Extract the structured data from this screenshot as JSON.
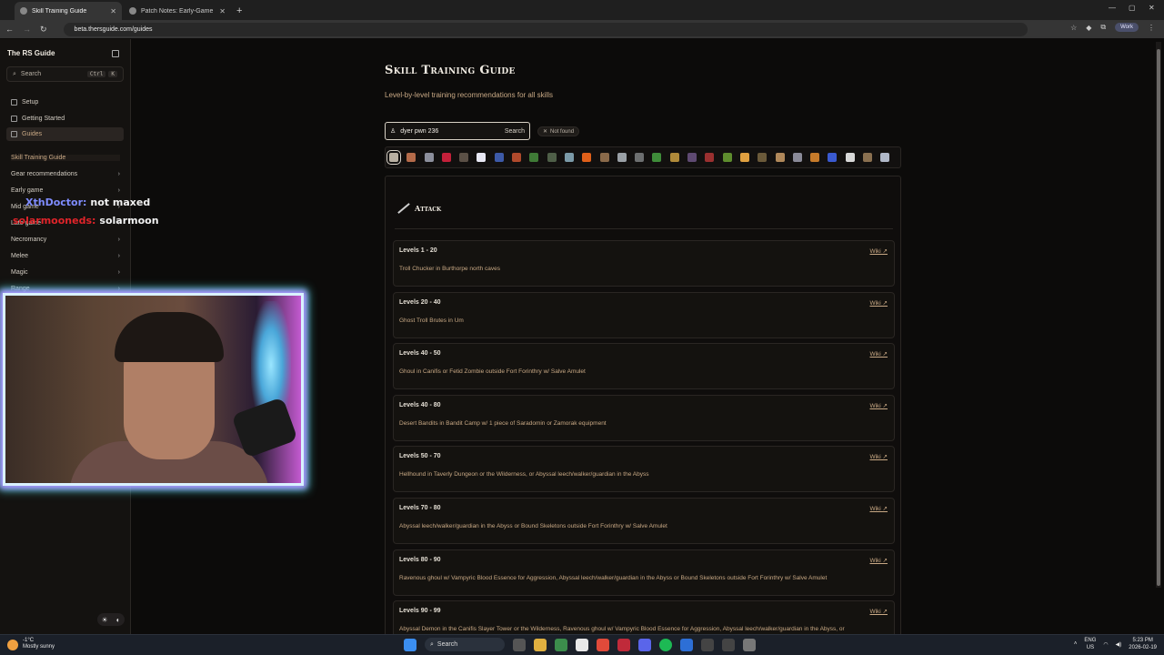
{
  "browser": {
    "tabs": [
      {
        "title": "Skill Training Guide",
        "active": true
      },
      {
        "title": "Patch Notes: Early-Game Rebal",
        "active": false
      }
    ],
    "new_tab": "+",
    "url": "beta.thersguide.com/guides",
    "profile": "Work"
  },
  "sidebar": {
    "site_title": "The RS Guide",
    "search": {
      "placeholder": "Search",
      "kbd": [
        "Ctrl",
        "K"
      ]
    },
    "nav": [
      {
        "label": "Setup"
      },
      {
        "label": "Getting Started"
      },
      {
        "label": "Guides",
        "active": true
      }
    ],
    "groups": [
      {
        "label": "Skill Training Guide",
        "active": true,
        "chevron": ""
      },
      {
        "label": "Gear recommendations",
        "chevron": "›"
      },
      {
        "label": "Early game",
        "chevron": "›"
      },
      {
        "label": "Mid game",
        "chevron": "›"
      },
      {
        "label": "Late game",
        "chevron": "›"
      },
      {
        "label": "Necromancy",
        "chevron": "›"
      },
      {
        "label": "Melee",
        "chevron": "›"
      },
      {
        "label": "Magic",
        "chevron": "›"
      },
      {
        "label": "Range",
        "chevron": "›"
      }
    ],
    "theme": {
      "light": "☀",
      "dark": "◐"
    }
  },
  "overlay": {
    "chat": [
      {
        "user": "XthDoctor:",
        "message": "not maxed"
      },
      {
        "user": "solarmooneds:",
        "message": "solarmoon"
      }
    ]
  },
  "main": {
    "title": "Skill Training Guide",
    "subtitle": "Level-by-level training recommendations for all skills",
    "search": {
      "value": "dyer pwn 236",
      "button": "Search"
    },
    "status_badge": "Not found",
    "skill_icons": [
      {
        "name": "attack",
        "color": "#b9b0a2"
      },
      {
        "name": "strength",
        "color": "#b56b4a"
      },
      {
        "name": "defence",
        "color": "#8c8f9c"
      },
      {
        "name": "constitution",
        "color": "#c4203a"
      },
      {
        "name": "ranged",
        "color": "#5b5046"
      },
      {
        "name": "prayer",
        "color": "#e8e8f4"
      },
      {
        "name": "magic",
        "color": "#3d5aa8"
      },
      {
        "name": "cooking",
        "color": "#b04a2c"
      },
      {
        "name": "woodcutting",
        "color": "#3f7a36"
      },
      {
        "name": "fletching",
        "color": "#4f5f48"
      },
      {
        "name": "fishing",
        "color": "#7b9aa8"
      },
      {
        "name": "firemaking",
        "color": "#e0601a"
      },
      {
        "name": "crafting",
        "color": "#8a6a4a"
      },
      {
        "name": "smithing",
        "color": "#9aa0a6"
      },
      {
        "name": "mining",
        "color": "#6d6f70"
      },
      {
        "name": "herblore",
        "color": "#3f8c3a"
      },
      {
        "name": "agility",
        "color": "#b08a3a"
      },
      {
        "name": "thieving",
        "color": "#5f4a72"
      },
      {
        "name": "slayer",
        "color": "#9a3030"
      },
      {
        "name": "farming",
        "color": "#5e8c2e"
      },
      {
        "name": "runecrafting",
        "color": "#e0a040"
      },
      {
        "name": "hunter",
        "color": "#6b5a3a"
      },
      {
        "name": "construction",
        "color": "#b0885a"
      },
      {
        "name": "summoning",
        "color": "#8a8a98"
      },
      {
        "name": "dungeoneering",
        "color": "#c67a2a"
      },
      {
        "name": "divination",
        "color": "#3a5ad0"
      },
      {
        "name": "invention",
        "color": "#d8d8d8"
      },
      {
        "name": "archaeology",
        "color": "#8a7050"
      },
      {
        "name": "necromancy",
        "color": "#b0b8c8"
      }
    ],
    "skill": {
      "name": "Attack"
    },
    "rows": [
      {
        "levels": "Levels 1 - 20",
        "wiki": "Wiki ↗",
        "desc": "Troll Chucker in Burthorpe north caves"
      },
      {
        "levels": "Levels 20 - 40",
        "wiki": "Wiki ↗",
        "desc": "Ghost Troll Brutes in Um"
      },
      {
        "levels": "Levels 40 - 50",
        "wiki": "Wiki ↗",
        "desc": "Ghoul in Canifis or Fetid Zombie outside Fort Forinthry w/ Salve Amulet"
      },
      {
        "levels": "Levels 40 - 80",
        "wiki": "Wiki ↗",
        "desc": "Desert Bandits in Bandit Camp w/ 1 piece of Saradomin or Zamorak equipment"
      },
      {
        "levels": "Levels 50 - 70",
        "wiki": "Wiki ↗",
        "desc": "Hellhound in Taverly Dungeon or the Wilderness, or Abyssal leech/walker/guardian in the Abyss"
      },
      {
        "levels": "Levels 70 - 80",
        "wiki": "Wiki ↗",
        "desc": "Abyssal leech/walker/guardian in the Abyss or Bound Skeletons outside Fort Forinthry w/ Salve Amulet"
      },
      {
        "levels": "Levels 80 - 90",
        "wiki": "Wiki ↗",
        "desc": "Ravenous ghoul w/ Vampyric Blood Essence for Aggression, Abyssal leech/walker/guardian in the Abyss or Bound Skeletons outside Fort Forinthry w/ Salve Amulet"
      },
      {
        "levels": "Levels 90 - 99",
        "wiki": "Wiki ↗",
        "desc": "Abyssal Demon in the Canifis Slayer Tower or the Wilderness, Ravenous ghoul w/ Vampyric Blood Essence for Aggression, Abyssal leech/walker/guardian in the Abyss, or"
      }
    ]
  },
  "taskbar": {
    "weather": {
      "temp": "-1°C",
      "desc": "Mostly sunny"
    },
    "search": "Search",
    "lang": [
      "ENG",
      "US"
    ],
    "time": "5:23 PM",
    "date": "2026-02-19"
  }
}
